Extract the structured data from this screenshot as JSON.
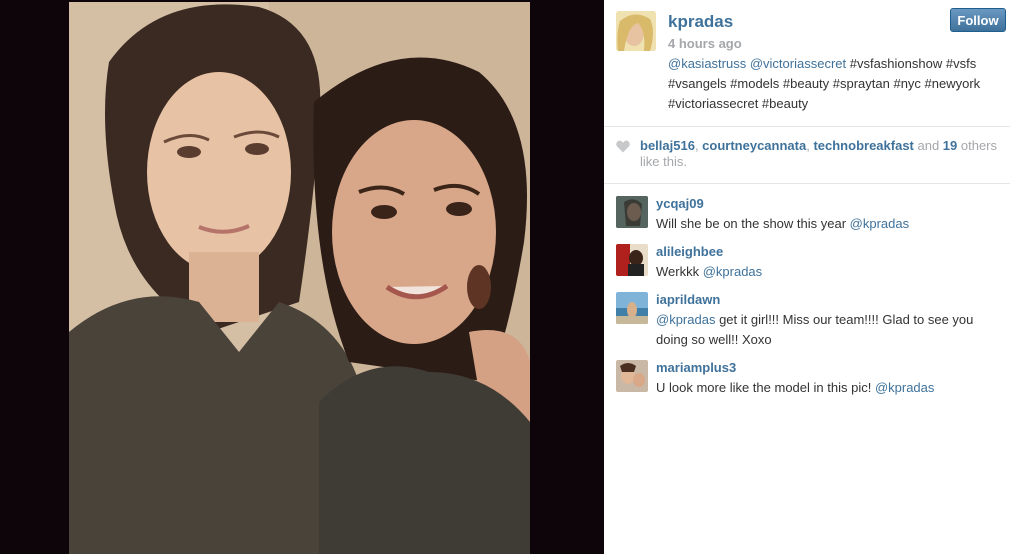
{
  "post": {
    "owner": "kpradas",
    "timestamp": "4 hours ago",
    "follow_label": "Follow",
    "caption": {
      "mention1": "@kasiastruss",
      "mention2": "@victoriassecret",
      "hashtags": " #vsfashionshow #vsfs #vsangels #models #beauty #spraytan #nyc #newyork #victoriassecret #beauty"
    },
    "photo_icon": "selfie-photo"
  },
  "likes": {
    "heart_icon": "heart-icon",
    "user1": "bellaj516",
    "sep1": ", ",
    "user2": "courtneycannata",
    "sep2": ", ",
    "user3": "technobreakfast",
    "and_text": " and ",
    "count": "19",
    "suffix": " others like this."
  },
  "comments": [
    {
      "user": "ycqaj09",
      "text": "Will she be on the show this year ",
      "mention": "@kpradas",
      "after": ""
    },
    {
      "user": "alileighbee",
      "text": "Werkkk ",
      "mention": "@kpradas",
      "after": ""
    },
    {
      "user": "iaprildawn",
      "text": "",
      "mention": "@kpradas",
      "after": " get it girl!!! Miss our team!!!! Glad to see you doing so well!! Xoxo"
    },
    {
      "user": "mariamplus3",
      "text": "U look more like the model in this pic! ",
      "mention": "@kpradas",
      "after": ""
    }
  ],
  "colors": {
    "link": "#3f729b",
    "muted": "#a5a7aa",
    "text": "#333333",
    "photo_bg": "#0d0509"
  }
}
